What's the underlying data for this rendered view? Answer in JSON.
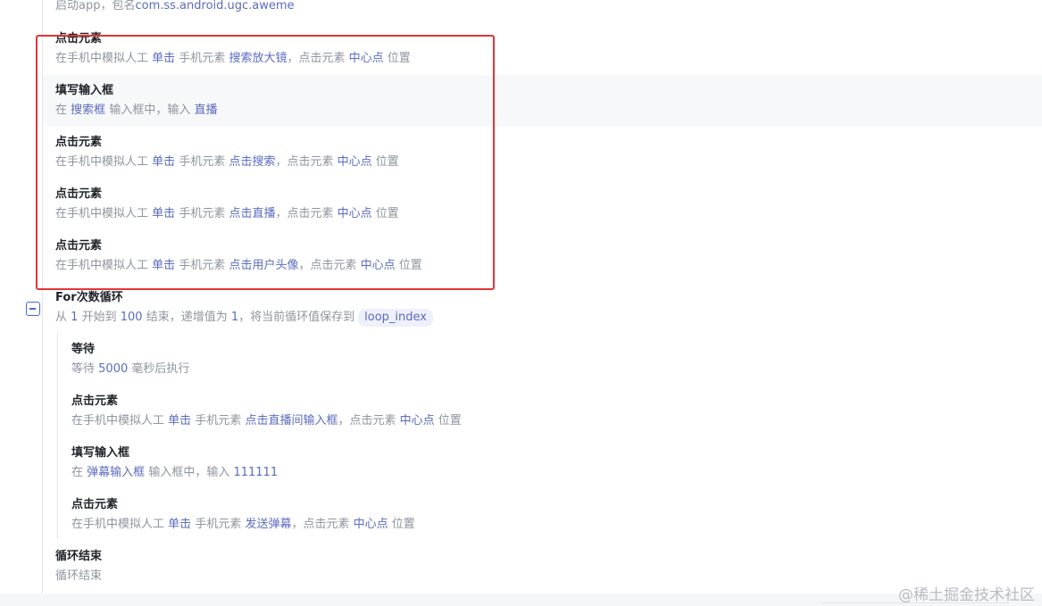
{
  "launch_step": {
    "desc_prefix": "启动app，包名",
    "package": "com.ss.android.ugc.aweme"
  },
  "steps": [
    {
      "title": "点击元素",
      "p1": "在手机中模拟人工",
      "action": "单击",
      "p2": "手机元素",
      "target": "搜索放大镜",
      "p3": "，点击元素",
      "point": "中心点",
      "p4": "位置"
    },
    {
      "title": "填写输入框",
      "p1": "在",
      "field": "搜索框",
      "p2": "输入框中，输入",
      "value": "直播"
    },
    {
      "title": "点击元素",
      "p1": "在手机中模拟人工",
      "action": "单击",
      "p2": "手机元素",
      "target": "点击搜索",
      "p3": "，点击元素",
      "point": "中心点",
      "p4": "位置"
    },
    {
      "title": "点击元素",
      "p1": "在手机中模拟人工",
      "action": "单击",
      "p2": "手机元素",
      "target": "点击直播",
      "p3": "，点击元素",
      "point": "中心点",
      "p4": "位置"
    },
    {
      "title": "点击元素",
      "p1": "在手机中模拟人工",
      "action": "单击",
      "p2": "手机元素",
      "target": "点击用户头像",
      "p3": "，点击元素",
      "point": "中心点",
      "p4": "位置"
    }
  ],
  "loop": {
    "title": "For次数循环",
    "p1": "从",
    "start": "1",
    "p2": "开始到",
    "end": "100",
    "p3": "结束，递增值为",
    "step": "1",
    "p4": "，将当前循环值保存到",
    "var": "loop_index"
  },
  "loop_steps": [
    {
      "title": "等待",
      "p1": "等待",
      "ms": "5000",
      "p2": "毫秒后执行"
    },
    {
      "title": "点击元素",
      "p1": "在手机中模拟人工",
      "action": "单击",
      "p2": "手机元素",
      "target": "点击直播间输入框",
      "p3": "，点击元素",
      "point": "中心点",
      "p4": "位置"
    },
    {
      "title": "填写输入框",
      "p1": "在",
      "field": "弹幕输入框",
      "p2": "输入框中，输入",
      "value": "111111"
    },
    {
      "title": "点击元素",
      "p1": "在手机中模拟人工",
      "action": "单击",
      "p2": "手机元素",
      "target": "发送弹幕",
      "p3": "，点击元素",
      "point": "中心点",
      "p4": "位置"
    }
  ],
  "loop_end": {
    "title": "循环结束",
    "desc": "循环结束"
  },
  "watermark": "@稀土掘金技术社区",
  "colors": {
    "highlight": "#5b6bc0",
    "annotation_box": "#e0353a",
    "collapse_icon": "#4d68d6"
  }
}
